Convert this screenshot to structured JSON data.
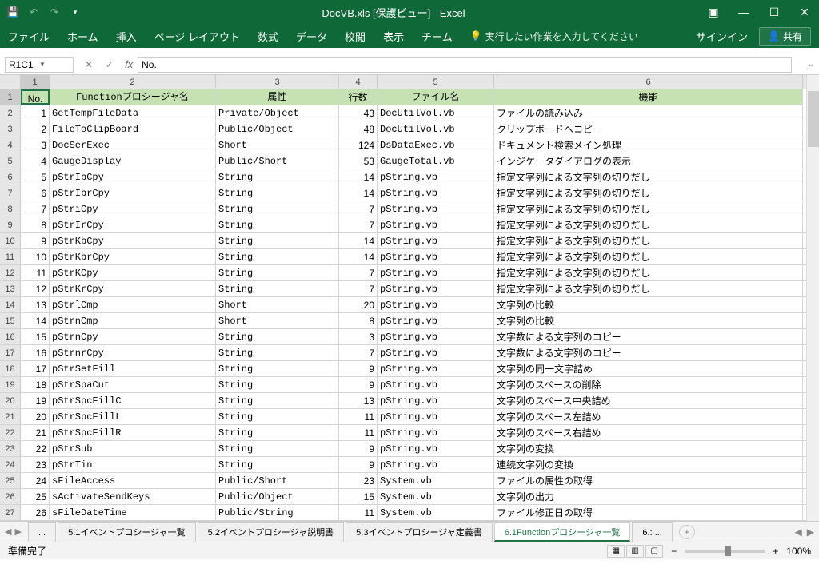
{
  "titlebar": {
    "title": "DocVB.xls [保護ビュー] - Excel"
  },
  "ribbon": {
    "file": "ファイル",
    "home": "ホーム",
    "insert": "挿入",
    "pagelayout": "ページ レイアウト",
    "formulas": "数式",
    "data": "データ",
    "review": "校閲",
    "view": "表示",
    "team": "チーム",
    "tellme": "実行したい作業を入力してください",
    "signin": "サインイン",
    "share": "共有"
  },
  "formulabar": {
    "namebox": "R1C1",
    "value": "No."
  },
  "colheaders": [
    "1",
    "2",
    "3",
    "4",
    "5",
    "6"
  ],
  "headers": {
    "no": "No.",
    "func": "Functionプロシージャ名",
    "attr": "属性",
    "lines": "行数",
    "file": "ファイル名",
    "feature": "機能"
  },
  "rows": [
    {
      "no": "1",
      "func": "GetTempFileData",
      "attr": "Private/Object",
      "lines": "43",
      "file": "DocUtilVol.vb",
      "feature": "ファイルの読み込み"
    },
    {
      "no": "2",
      "func": "FileToClipBoard",
      "attr": "Public/Object",
      "lines": "48",
      "file": "DocUtilVol.vb",
      "feature": "クリップボードへコピー"
    },
    {
      "no": "3",
      "func": "DocSerExec",
      "attr": "Short",
      "lines": "124",
      "file": "DsDataExec.vb",
      "feature": "ドキュメント検索メイン処理"
    },
    {
      "no": "4",
      "func": "GaugeDisplay",
      "attr": "Public/Short",
      "lines": "53",
      "file": "GaugeTotal.vb",
      "feature": "インジケータダイアログの表示"
    },
    {
      "no": "5",
      "func": "pStrIbCpy",
      "attr": "String",
      "lines": "14",
      "file": "pString.vb",
      "feature": "指定文字列による文字列の切りだし"
    },
    {
      "no": "6",
      "func": "pStrIbrCpy",
      "attr": "String",
      "lines": "14",
      "file": "pString.vb",
      "feature": "指定文字列による文字列の切りだし"
    },
    {
      "no": "7",
      "func": "pStriCpy",
      "attr": "String",
      "lines": "7",
      "file": "pString.vb",
      "feature": "指定文字列による文字列の切りだし"
    },
    {
      "no": "8",
      "func": "pStrIrCpy",
      "attr": "String",
      "lines": "7",
      "file": "pString.vb",
      "feature": "指定文字列による文字列の切りだし"
    },
    {
      "no": "9",
      "func": "pStrKbCpy",
      "attr": "String",
      "lines": "14",
      "file": "pString.vb",
      "feature": "指定文字列による文字列の切りだし"
    },
    {
      "no": "10",
      "func": "pStrKbrCpy",
      "attr": "String",
      "lines": "14",
      "file": "pString.vb",
      "feature": "指定文字列による文字列の切りだし"
    },
    {
      "no": "11",
      "func": "pStrKCpy",
      "attr": "String",
      "lines": "7",
      "file": "pString.vb",
      "feature": "指定文字列による文字列の切りだし"
    },
    {
      "no": "12",
      "func": "pStrKrCpy",
      "attr": "String",
      "lines": "7",
      "file": "pString.vb",
      "feature": "指定文字列による文字列の切りだし"
    },
    {
      "no": "13",
      "func": "pStrlCmp",
      "attr": "Short",
      "lines": "20",
      "file": "pString.vb",
      "feature": "文字列の比較"
    },
    {
      "no": "14",
      "func": "pStrnCmp",
      "attr": "Short",
      "lines": "8",
      "file": "pString.vb",
      "feature": "文字列の比較"
    },
    {
      "no": "15",
      "func": "pStrnCpy",
      "attr": "String",
      "lines": "3",
      "file": "pString.vb",
      "feature": "文字数による文字列のコピー"
    },
    {
      "no": "16",
      "func": "pStrnrCpy",
      "attr": "String",
      "lines": "7",
      "file": "pString.vb",
      "feature": "文字数による文字列のコピー"
    },
    {
      "no": "17",
      "func": "pStrSetFill",
      "attr": "String",
      "lines": "9",
      "file": "pString.vb",
      "feature": "文字列の同一文字詰め"
    },
    {
      "no": "18",
      "func": "pStrSpaCut",
      "attr": "String",
      "lines": "9",
      "file": "pString.vb",
      "feature": "文字列のスペースの削除"
    },
    {
      "no": "19",
      "func": "pStrSpcFillC",
      "attr": "String",
      "lines": "13",
      "file": "pString.vb",
      "feature": "文字列のスペース中央詰め"
    },
    {
      "no": "20",
      "func": "pStrSpcFillL",
      "attr": "String",
      "lines": "11",
      "file": "pString.vb",
      "feature": "文字列のスペース左詰め"
    },
    {
      "no": "21",
      "func": "pStrSpcFillR",
      "attr": "String",
      "lines": "11",
      "file": "pString.vb",
      "feature": "文字列のスペース右詰め"
    },
    {
      "no": "22",
      "func": "pStrSub",
      "attr": "String",
      "lines": "9",
      "file": "pString.vb",
      "feature": "文字列の変換"
    },
    {
      "no": "23",
      "func": "pStrTin",
      "attr": "String",
      "lines": "9",
      "file": "pString.vb",
      "feature": "連続文字列の変換"
    },
    {
      "no": "24",
      "func": "sFileAccess",
      "attr": "Public/Short",
      "lines": "23",
      "file": "System.vb",
      "feature": "ファイルの属性の取得"
    },
    {
      "no": "25",
      "func": "sActivateSendKeys",
      "attr": "Public/Object",
      "lines": "15",
      "file": "System.vb",
      "feature": "文字列の出力"
    },
    {
      "no": "26",
      "func": "sFileDateTime",
      "attr": "Public/String",
      "lines": "11",
      "file": "System.vb",
      "feature": "ファイル修正日の取得"
    }
  ],
  "tabs": {
    "ellipsis": "...",
    "t1": "5.1イベントプロシージャ一覧",
    "t2": "5.2イベントプロシージャ説明書",
    "t3": "5.3イベントプロシージャ定義書",
    "t4": "6.1Functionプロシージャ一覧",
    "t5": "6.: ..."
  },
  "statusbar": {
    "ready": "準備完了",
    "zoom": "100%"
  }
}
